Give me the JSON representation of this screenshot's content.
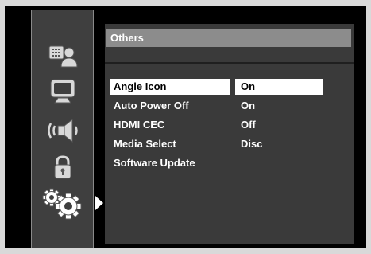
{
  "sidebar": {
    "icons": [
      {
        "name": "language-person-icon"
      },
      {
        "name": "display-icon"
      },
      {
        "name": "audio-speaker-icon"
      },
      {
        "name": "lock-icon"
      },
      {
        "name": "gears-icon"
      }
    ],
    "active_index": 4
  },
  "panel": {
    "title": "Others",
    "items": [
      {
        "label": "Angle Icon",
        "value": "On",
        "selected": true
      },
      {
        "label": "Auto Power Off",
        "value": "On"
      },
      {
        "label": "HDMI CEC",
        "value": "Off"
      },
      {
        "label": "Media Select",
        "value": "Disc"
      },
      {
        "label": "Software Update",
        "value": ""
      }
    ]
  },
  "colors": {
    "background": "#000000",
    "panel": "#3a3a3a",
    "header": "#8c8c8c",
    "sidebar": "#3f3f3f",
    "highlight": "#ffffff"
  }
}
